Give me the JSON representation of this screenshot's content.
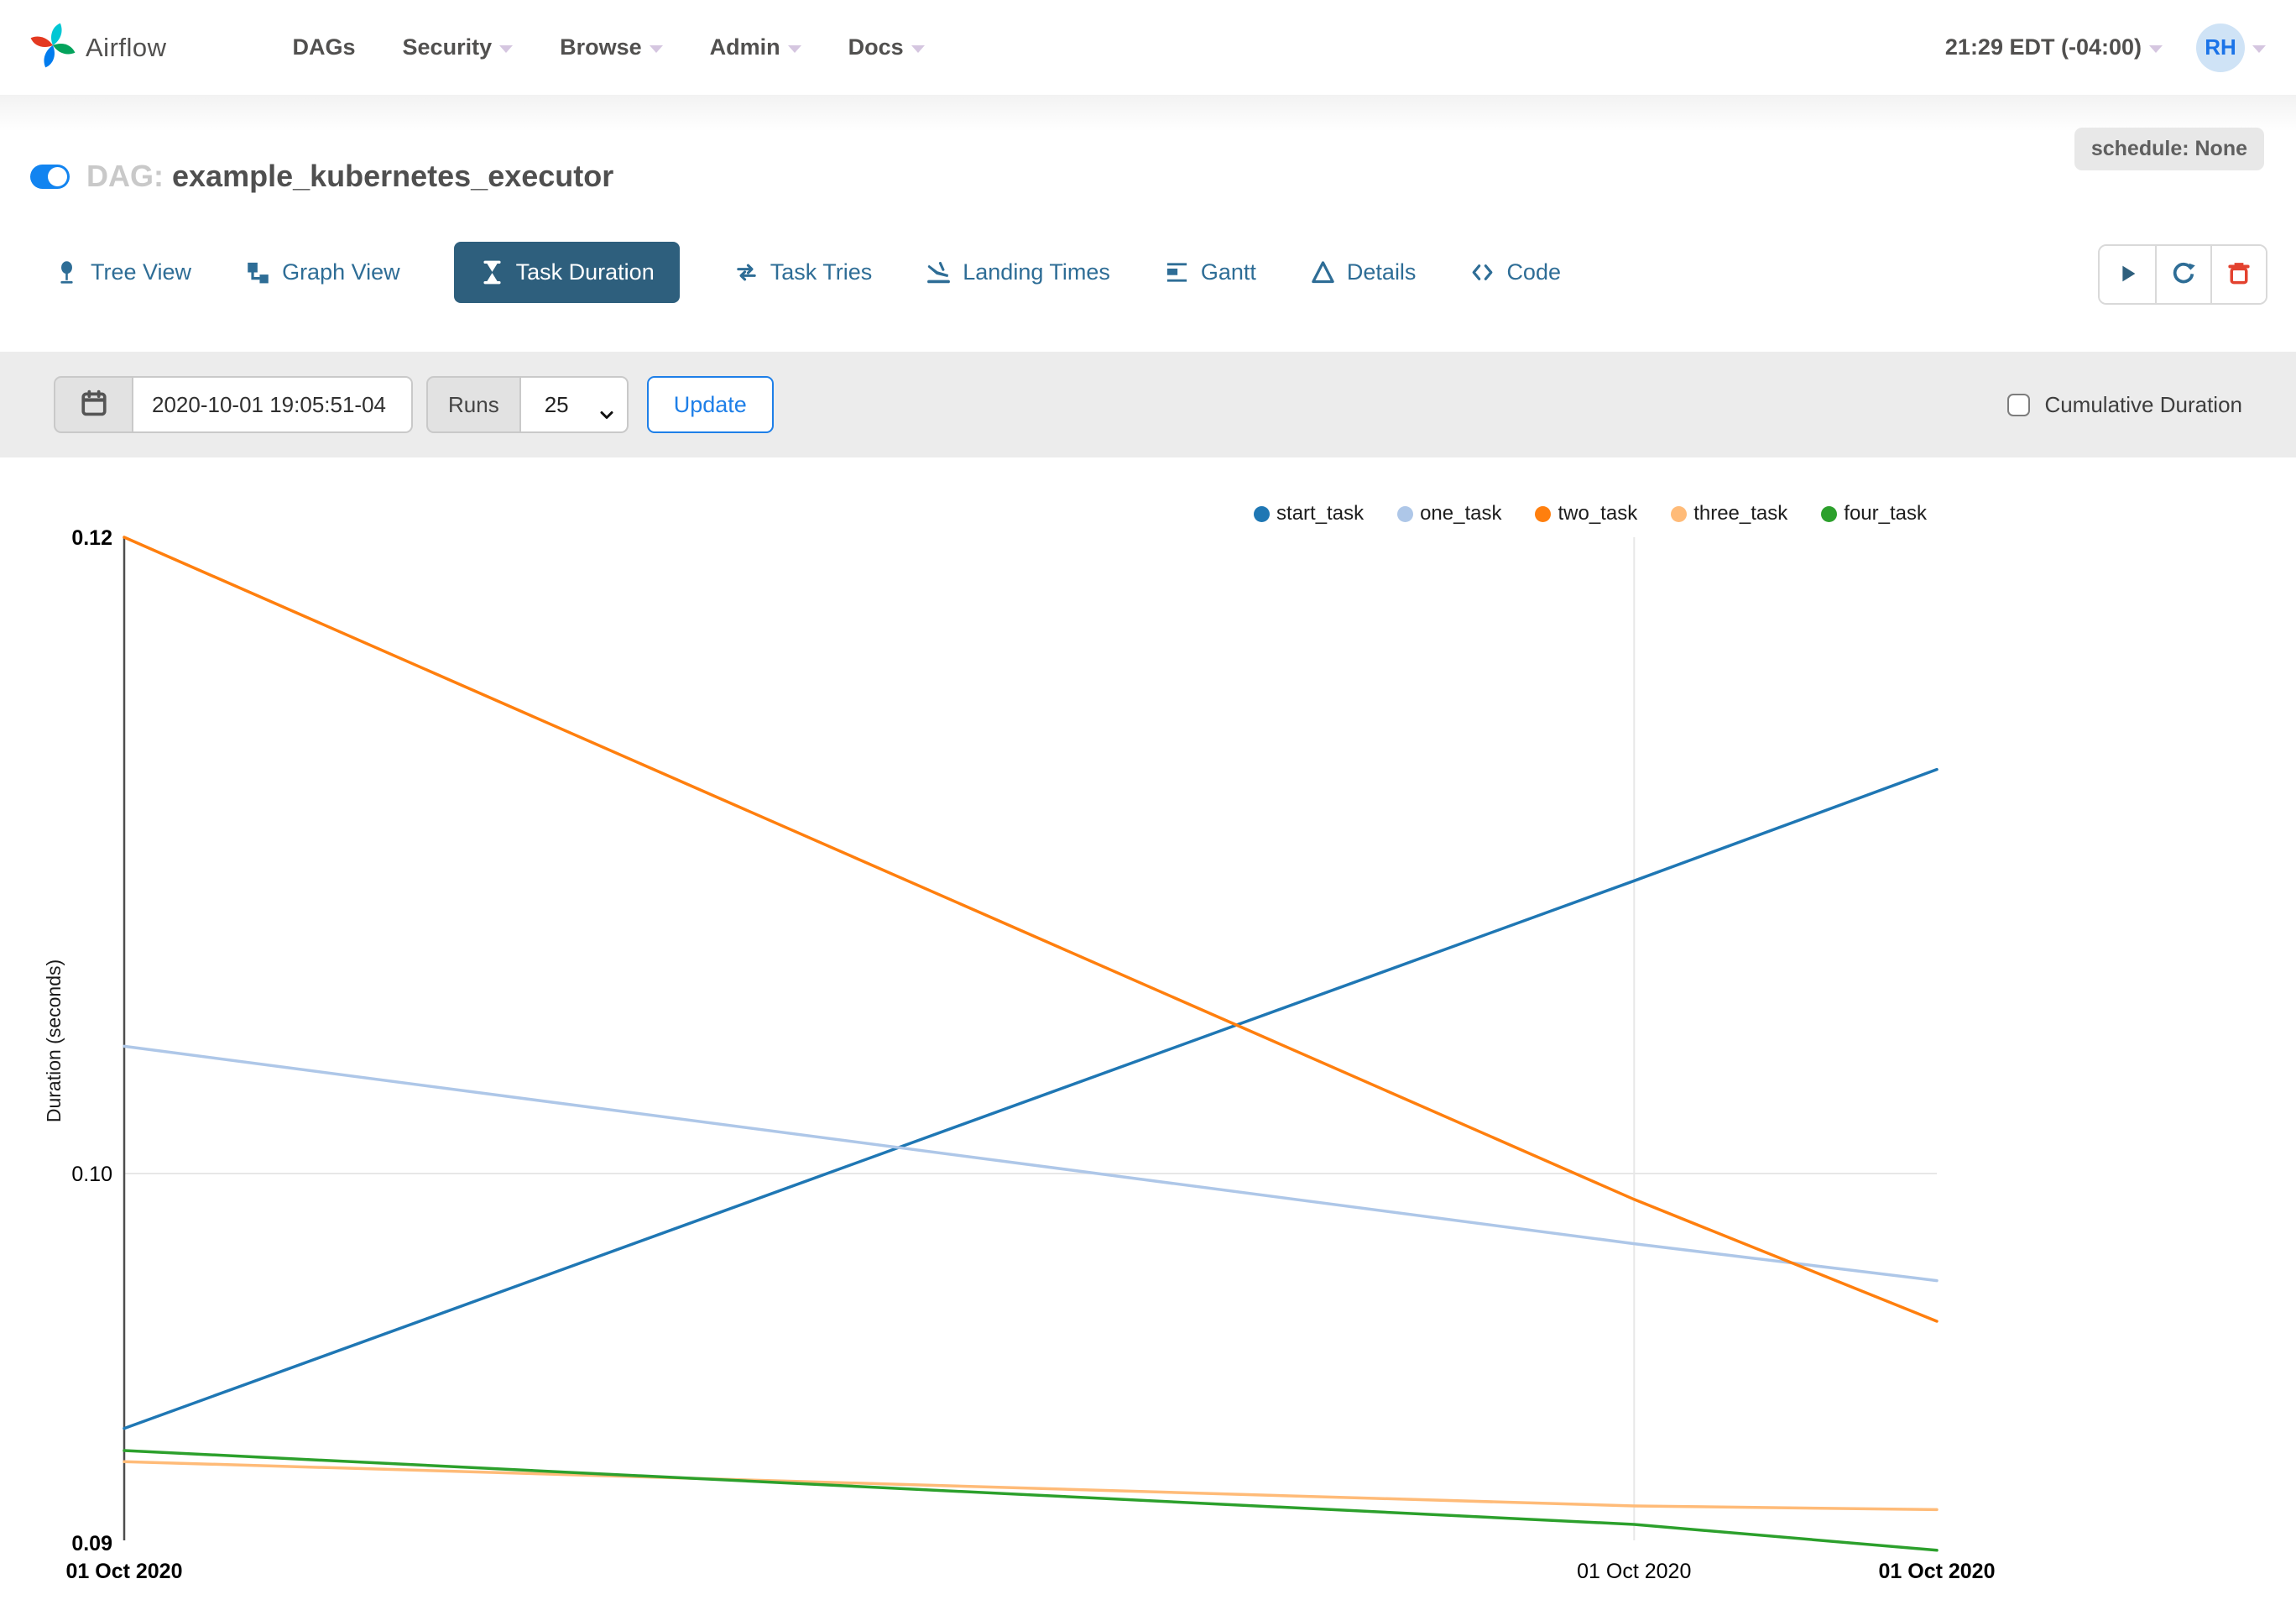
{
  "navbar": {
    "brand": {
      "logo_icon": "airflow-pinwheel-logo",
      "label": "Airflow"
    },
    "menu_items": [
      {
        "label": "DAGs",
        "has_caret": false
      },
      {
        "label": "Security",
        "has_caret": true
      },
      {
        "label": "Browse",
        "has_caret": true
      },
      {
        "label": "Admin",
        "has_caret": true
      },
      {
        "label": "Docs",
        "has_caret": true
      }
    ],
    "clock": {
      "time_label": "21:29 EDT (-04:00)",
      "has_caret": true
    },
    "user": {
      "avatar_initials": "RH",
      "has_caret": true
    }
  },
  "dag_header": {
    "pause_toggle_state": "on",
    "title_prefix": "DAG:",
    "dag_name": "example_kubernetes_executor",
    "schedule_badge": "schedule: None"
  },
  "view_tabs": [
    {
      "label": "Tree View",
      "icon": "pin-icon",
      "active": false
    },
    {
      "label": "Graph View",
      "icon": "sitemap-icon",
      "active": false
    },
    {
      "label": "Task Duration",
      "icon": "hourglass-icon",
      "active": true
    },
    {
      "label": "Task Tries",
      "icon": "repeat-icon",
      "active": false
    },
    {
      "label": "Landing Times",
      "icon": "plane-landing-icon",
      "active": false
    },
    {
      "label": "Gantt",
      "icon": "gantt-bars-icon",
      "active": false
    },
    {
      "label": "Details",
      "icon": "triangle-outline-icon",
      "active": false
    },
    {
      "label": "Code",
      "icon": "code-brackets-icon",
      "active": false
    }
  ],
  "dag_actions": [
    {
      "icon": "play-icon"
    },
    {
      "icon": "refresh-icon"
    },
    {
      "icon": "delete-icon"
    }
  ],
  "filter_bar": {
    "calendar_icon": "calendar-icon",
    "base_date_value": "2020-10-01 19:05:51-04",
    "runs_label": "Runs",
    "runs_value": "25",
    "update_label": "Update",
    "cumulative_checkbox": {
      "label": "Cumulative Duration",
      "checked": false
    }
  },
  "chart_data": {
    "type": "line",
    "title": "",
    "xlabel": "",
    "ylabel": "Duration (seconds)",
    "x_tick_labels": [
      "01 Oct 2020",
      "01 Oct 2020",
      "01 Oct 2020"
    ],
    "x_fractions": [
      0,
      0.833,
      1
    ],
    "y_ticks": [
      {
        "label": "0.12",
        "value": 0.12,
        "bold": true
      },
      {
        "label": "0.10",
        "value": 0.1,
        "bold": false
      },
      {
        "label": "0.09",
        "value": 0.09,
        "bold": true
      }
    ],
    "ylim": [
      0.09,
      0.12
    ],
    "grid": {
      "horizontal_gridline_value": 0.1,
      "vertical_gridline_fraction": 0.833
    },
    "legend_position": "top-right",
    "series": [
      {
        "name": "start_task",
        "color": "#1f77b4",
        "values": [
          0.0931,
          0.1092,
          0.1127
        ]
      },
      {
        "name": "one_task",
        "color": "#aec7e8",
        "values": [
          0.104,
          0.0981,
          0.0971
        ]
      },
      {
        "name": "two_task",
        "color": "#ff7f0e",
        "values": [
          0.12,
          0.0993,
          0.096
        ]
      },
      {
        "name": "three_task",
        "color": "#ffbb78",
        "values": [
          0.0922,
          0.091,
          0.0909
        ]
      },
      {
        "name": "four_task",
        "color": "#2ca02c",
        "values": [
          0.0925,
          0.0905,
          0.0898
        ]
      }
    ]
  },
  "colors": {
    "active_tab_bg": "#2e5f7d",
    "tab_link": "#2e6d96",
    "update_blue": "#1e7fe8",
    "delete_red": "#e3422f",
    "toggle_blue": "#1284f0",
    "navbar_text": "#51504f",
    "gridline": "#e7e7e7",
    "axis_line": "#4d4d4d"
  }
}
